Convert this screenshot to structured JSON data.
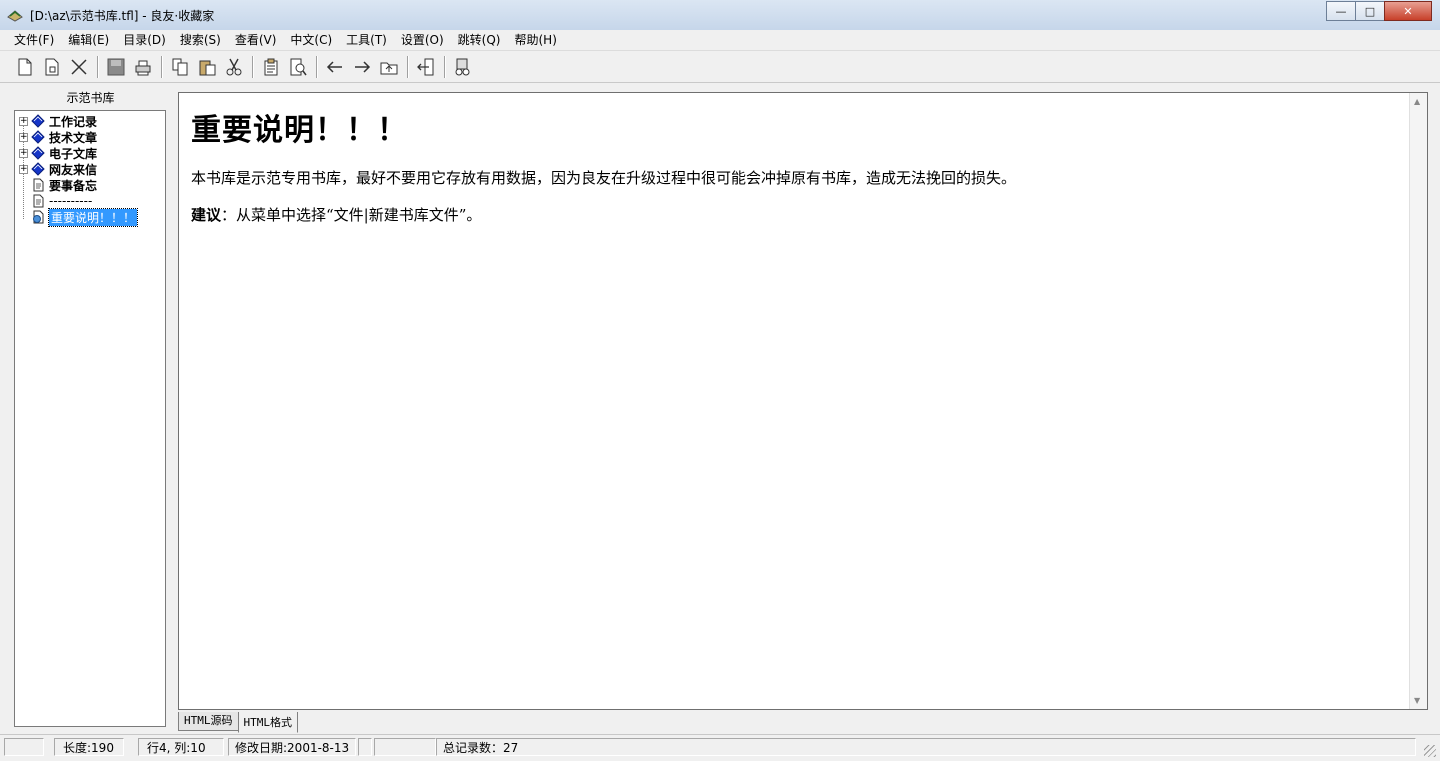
{
  "window": {
    "title": "[D:\\az\\示范书库.tfl] - 良友·收藏家",
    "min_label": "—",
    "max_label": "□",
    "close_label": "✕"
  },
  "menu": [
    "文件(F)",
    "编辑(E)",
    "目录(D)",
    "搜索(S)",
    "查看(V)",
    "中文(C)",
    "工具(T)",
    "设置(O)",
    "跳转(Q)",
    "帮助(H)"
  ],
  "toolbar": {
    "icons": [
      "new-file-icon",
      "new-page-icon",
      "delete-icon",
      "save-icon",
      "print-icon",
      "copy-icon",
      "paste-icon",
      "cut-icon",
      "properties-icon",
      "preview-icon",
      "back-arrow-icon",
      "forward-arrow-icon",
      "up-folder-icon",
      "exit-icon",
      "search-binoculars-icon"
    ]
  },
  "tree": {
    "header": "示范书库",
    "nodes": [
      {
        "label": "工作记录",
        "type": "book",
        "expandable": true,
        "bold": true,
        "selected": false
      },
      {
        "label": "技术文章",
        "type": "book",
        "expandable": true,
        "bold": true,
        "selected": false
      },
      {
        "label": "电子文库",
        "type": "book",
        "expandable": true,
        "bold": true,
        "selected": false
      },
      {
        "label": "网友来信",
        "type": "book",
        "expandable": true,
        "bold": true,
        "selected": false
      },
      {
        "label": "要事备忘",
        "type": "page",
        "expandable": false,
        "bold": true,
        "selected": false
      },
      {
        "label": "----------",
        "type": "page",
        "expandable": false,
        "bold": false,
        "selected": false
      },
      {
        "label": "重要说明！！！",
        "type": "html",
        "expandable": false,
        "bold": false,
        "selected": true
      }
    ]
  },
  "document": {
    "title": "重要说明！！！",
    "paragraph1": "本书库是示范专用书库，最好不要用它存放有用数据，因为良友在升级过程中很可能会冲掉原有书库，造成无法挽回的损失。",
    "advice_label": "建议",
    "advice_text": "：从菜单中选择“文件|新建书库文件”。"
  },
  "tabs": [
    "HTML源码",
    "HTML格式"
  ],
  "active_tab": "HTML格式",
  "status": {
    "length": "长度:190",
    "position": "行4, 列:10",
    "modified": "修改日期:2001-8-13",
    "total": "总记录数：27"
  },
  "colors": {
    "selection": "#3399ff",
    "book_icon": "#1535c8"
  }
}
